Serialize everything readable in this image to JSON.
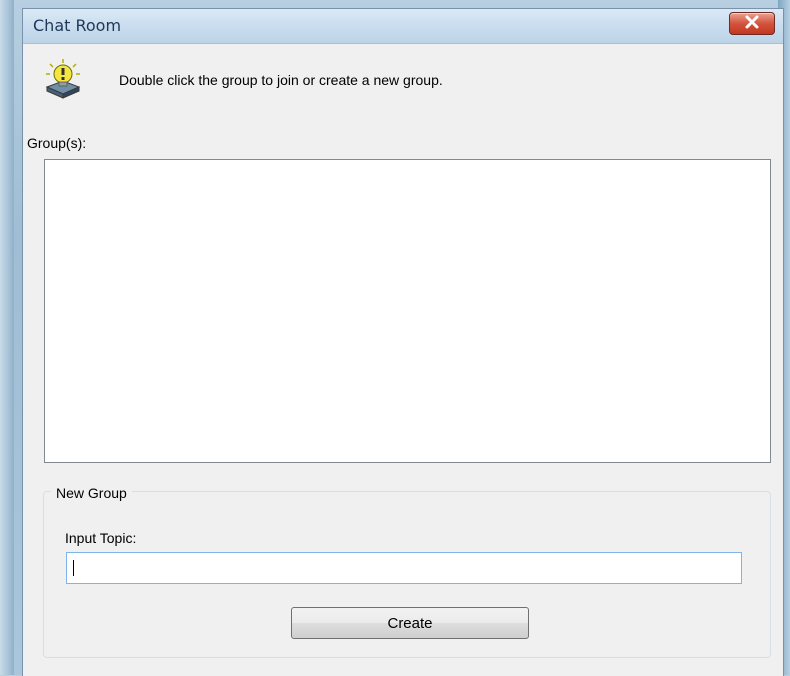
{
  "window": {
    "title": "Chat Room",
    "close_icon": "close-x-icon"
  },
  "info": {
    "icon": "lightbulb-info-icon",
    "text": "Double click the group to join or create a new group."
  },
  "groups": {
    "label": "Group(s):",
    "items": []
  },
  "new_group": {
    "legend": "New Group",
    "topic_label": "Input Topic:",
    "topic_value": "",
    "create_label": "Create"
  },
  "colors": {
    "titlebar": "#c8dcee",
    "close_button": "#c7412a",
    "input_border": "#7eb4ea"
  }
}
